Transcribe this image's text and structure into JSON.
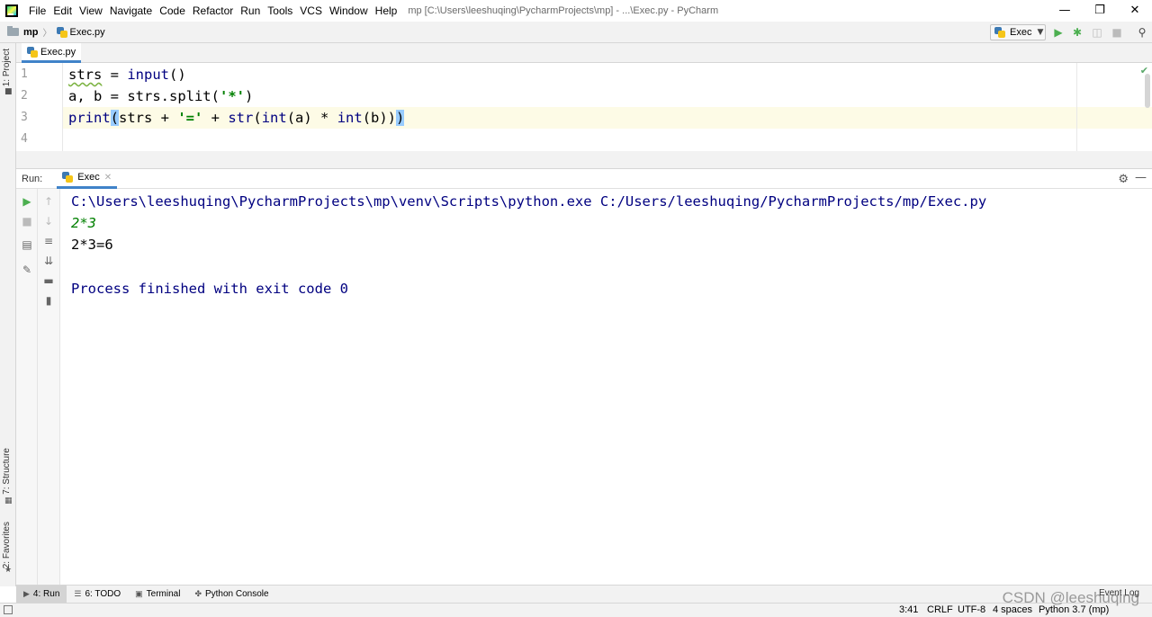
{
  "window": {
    "title": "mp [C:\\Users\\leeshuqing\\PycharmProjects\\mp] - ...\\Exec.py - PyCharm",
    "minimize": "—",
    "maximize": "❐",
    "close": "✕"
  },
  "menu": [
    "File",
    "Edit",
    "View",
    "Navigate",
    "Code",
    "Refactor",
    "Run",
    "Tools",
    "VCS",
    "Window",
    "Help"
  ],
  "navbar": {
    "project": "mp",
    "file": "Exec.py",
    "run_config": "Exec"
  },
  "left_strip": {
    "project_tab": "1: Project",
    "structure_tab": "7: Structure",
    "favorites_tab": "2: Favorites"
  },
  "editor": {
    "tab_label": "Exec.py",
    "line_numbers": [
      "1",
      "2",
      "3",
      "4"
    ],
    "lines": {
      "l1_var": "strs",
      "l1_eq": " = ",
      "l1_fn": "input",
      "l1_rest": "()",
      "l2_lhs": "a, b = strs.split(",
      "l2_str": "'*'",
      "l2_rest": ")",
      "l3_fn": "print",
      "l3_open": "(",
      "l3_mid1": "strs + ",
      "l3_str": "'='",
      "l3_mid2": " + ",
      "l3_fn2": "str",
      "l3_p1": "(",
      "l3_fn3": "int",
      "l3_mid3": "(a) * ",
      "l3_fn4": "int",
      "l3_mid4": "(b))",
      "l3_close": ")"
    }
  },
  "run_panel": {
    "title": "Run:",
    "tab_label": "Exec",
    "console": {
      "command": "C:\\Users\\leeshuqing\\PycharmProjects\\mp\\venv\\Scripts\\python.exe C:/Users/leeshuqing/PycharmProjects/mp/Exec.py",
      "input": "2*3",
      "output": "2*3=6",
      "exit": "Process finished with exit code 0"
    }
  },
  "bottom_tabs": [
    {
      "label": "4: Run",
      "icon": "play-icon"
    },
    {
      "label": "6: TODO",
      "icon": "list-icon"
    },
    {
      "label": "Terminal",
      "icon": "terminal-icon"
    },
    {
      "label": "Python Console",
      "icon": "python-icon"
    }
  ],
  "bottom_right": {
    "event_log": "Event Log"
  },
  "statusbar": {
    "position": "3:41",
    "line_sep": "CRLF",
    "encoding": "UTF-8",
    "indent": "4 spaces",
    "interpreter": "Python 3.7 (mp)"
  },
  "watermark": "CSDN @leeshuqing",
  "colors": {
    "accent": "#4083c9",
    "string_green": "#008000",
    "builtin_navy": "#000080",
    "current_line": "#fdfbe6"
  }
}
